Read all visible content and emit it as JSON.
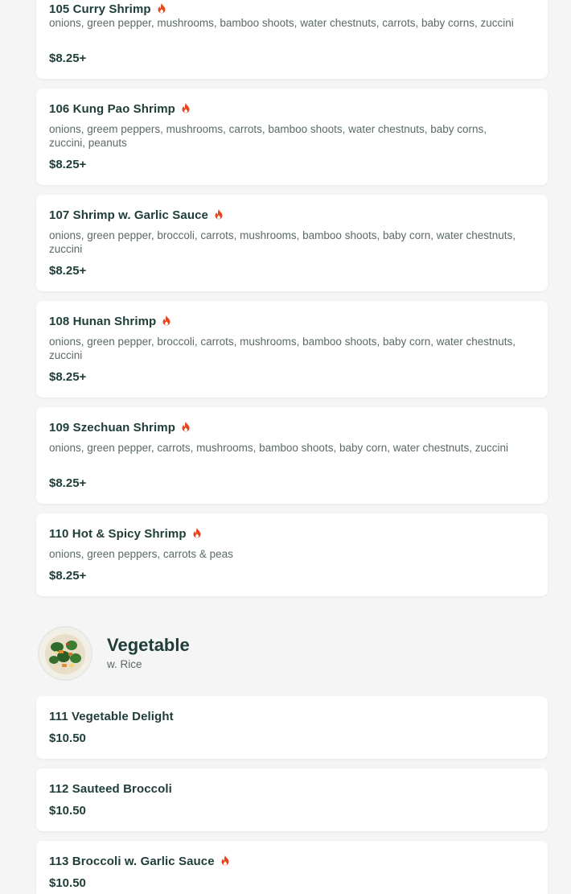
{
  "colors": {
    "accent": "#1e3d38",
    "spicy": "#e8451e",
    "card_bg": "#ffffff",
    "page_bg": "#f5f5f5"
  },
  "shrimp_items": [
    {
      "name": "105 Curry Shrimp",
      "spicy": true,
      "description": "onions, green pepper, mushrooms, bamboo shoots, water chestnuts, carrots, baby corns, zuccini",
      "price": "$8.25+"
    },
    {
      "name": "106 Kung Pao Shrimp",
      "spicy": true,
      "description": "onions, greem peppers, mushrooms, carrots, bamboo shoots, water chestnuts, baby corns, zuccini, peanuts",
      "price": "$8.25+"
    },
    {
      "name": "107 Shrimp w. Garlic Sauce",
      "spicy": true,
      "description": "onions, green pepper, broccoli, carrots, mushrooms, bamboo shoots, baby corn, water chestnuts, zuccini",
      "price": "$8.25+"
    },
    {
      "name": "108 Hunan Shrimp",
      "spicy": true,
      "description": "onions, green pepper, broccoli, carrots, mushrooms, bamboo shoots, baby corn, water chestnuts, zuccini",
      "price": "$8.25+"
    },
    {
      "name": "109 Szechuan Shrimp",
      "spicy": true,
      "description": "onions, green pepper, carrots, mushrooms, bamboo shoots, baby corn, water chestnuts, zuccini",
      "price": "$8.25+"
    },
    {
      "name": "110 Hot & Spicy Shrimp",
      "spicy": true,
      "description": "onions, green peppers, carrots & peas",
      "price": "$8.25+"
    }
  ],
  "vegetable_section": {
    "title": "Vegetable",
    "subtitle": "w. Rice",
    "image_icon": "vegetable-dish-image"
  },
  "vegetable_items": [
    {
      "name": "111 Vegetable Delight",
      "spicy": false,
      "price": "$10.50"
    },
    {
      "name": "112 Sauteed Broccoli",
      "spicy": false,
      "price": "$10.50"
    },
    {
      "name": "113 Broccoli w. Garlic Sauce",
      "spicy": true,
      "price": "$10.50"
    }
  ]
}
